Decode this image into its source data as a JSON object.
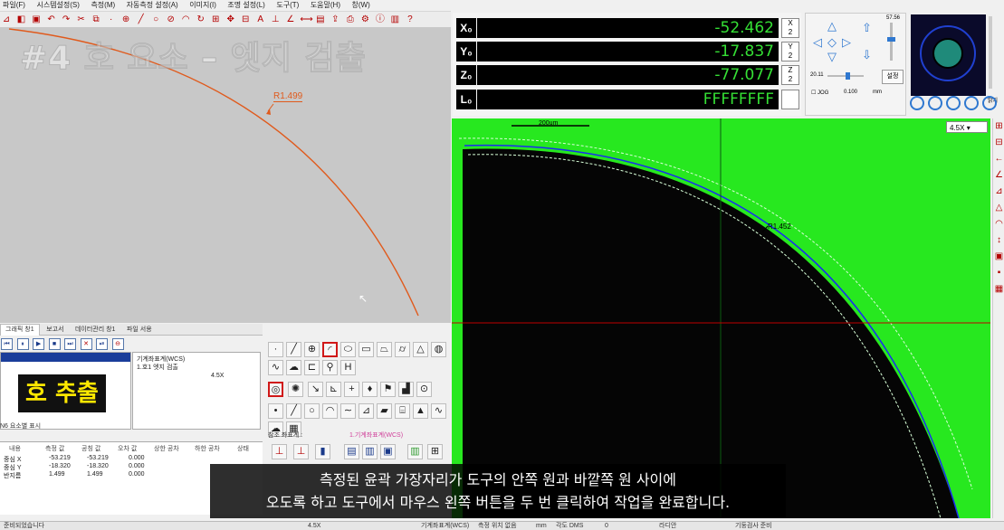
{
  "menu": [
    "파일(F)",
    "시스템설정(S)",
    "측정(M)",
    "자동측정 설정(A)",
    "이미지(I)",
    "조명 설정(L)",
    "도구(T)",
    "도움말(H)",
    "창(W)"
  ],
  "watermark": "#4 호 요소 – 엣지 검출",
  "cad": {
    "radius_label": "R1.499",
    "accent": "#e05a1c"
  },
  "dro": {
    "rows": [
      {
        "axis": "X₀",
        "value": "-52.462",
        "half": "X\n2"
      },
      {
        "axis": "Y₀",
        "value": "-17.837",
        "half": "Y\n2"
      },
      {
        "axis": "Z₀",
        "value": "-77.077",
        "half": "Z\n2"
      },
      {
        "axis": "L₀",
        "value": "FFFFFFFF",
        "half": ""
      }
    ],
    "value_color": "#35e035"
  },
  "stage": {
    "speed_top": "57.56",
    "speed_left": "20.11",
    "set_button": "설정",
    "jog_label": "JOG",
    "step_value": "0.100",
    "unit": "mm"
  },
  "light": {
    "label": "밝기"
  },
  "camera": {
    "zoom": "4.5X",
    "scale_label": "200um",
    "radius_label": "R1.452",
    "background": "#27e81f"
  },
  "tabs": [
    "그래픽 창1",
    "보고서",
    "데이터관리 창1",
    "파일 서용"
  ],
  "steps": {
    "caption": "호 추출",
    "status": "N6 요소별 표시"
  },
  "info": {
    "lines": [
      "기계좌표계(WCS)",
      "1.호1 엣지 검출",
      "4.5X"
    ]
  },
  "coord": {
    "label": "참조 좌표계 :",
    "value": "1.기계좌표계(WCS)"
  },
  "table": {
    "headers": [
      "내용",
      "측정 값",
      "공칭 값",
      "오차 값",
      "상한 공차",
      "하한 공차",
      "상태"
    ],
    "rows": [
      [
        "중심 X",
        "-53.219",
        "-53.219",
        "0.000"
      ],
      [
        "중심 Y",
        "-18.320",
        "-18.320",
        "0.000"
      ],
      [
        "반지름",
        "1.499",
        "1.499",
        "0.000"
      ]
    ]
  },
  "subtitle": {
    "line1": "측정된 윤곽 가장자리가 도구의 안쪽 원과 바깥쪽 원 사이에",
    "line2": "오도록 하고 도구에서 마우스 왼쪽 버튼을 두 번 클릭하여 작업을 완료합니다."
  },
  "statusbar": {
    "left": "준비되었습니다",
    "zoom": "4.5X",
    "coord": "기계좌표계(WCS)",
    "pos": "측정 위치 없음",
    "mm": "mm",
    "ang": "각도 DMS",
    "light": "0",
    "unit": "라디안",
    "time": "기둥검사 준비"
  }
}
